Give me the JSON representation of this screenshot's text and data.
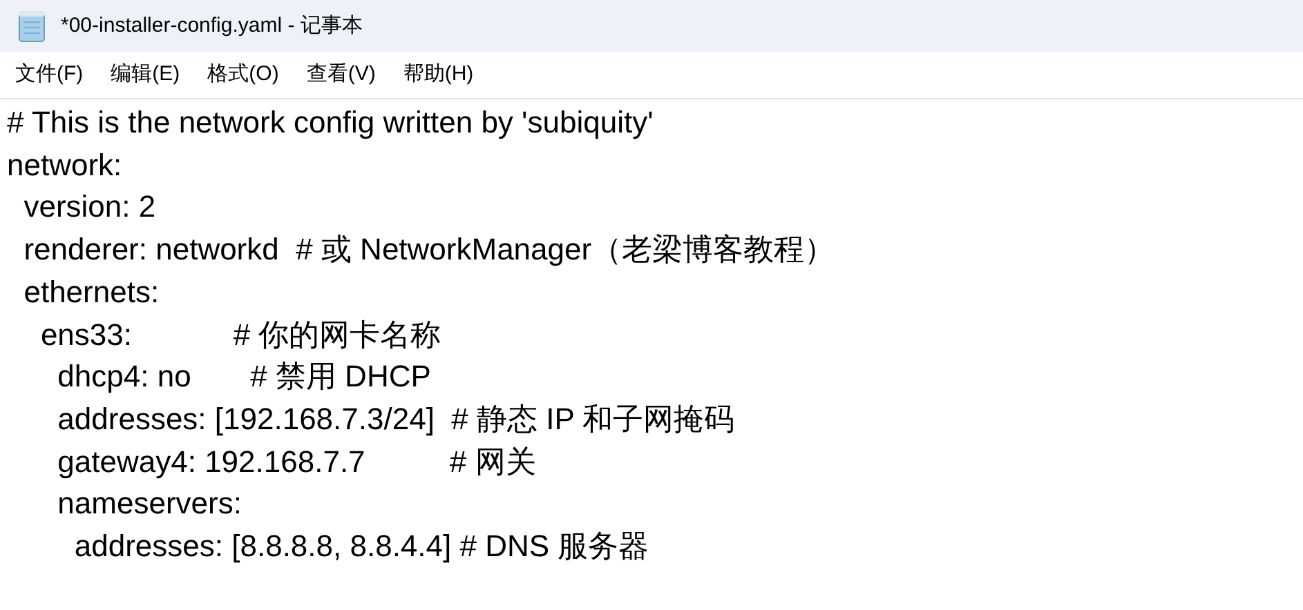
{
  "window": {
    "title": "*00-installer-config.yaml - 记事本"
  },
  "menu": [
    "文件(F)",
    "编辑(E)",
    "格式(O)",
    "查看(V)",
    "帮助(H)"
  ],
  "editor": {
    "lines": [
      "# This is the network config written by 'subiquity'",
      "network:",
      "  version: 2",
      "  renderer: networkd  # 或 NetworkManager（老梁博客教程）",
      "  ethernets:",
      "    ens33:            # 你的网卡名称",
      "      dhcp4: no       # 禁用 DHCP",
      "      addresses: [192.168.7.3/24]  # 静态 IP 和子网掩码",
      "      gateway4: 192.168.7.7          # 网关",
      "      nameservers:",
      "        addresses: [8.8.8.8, 8.8.4.4] # DNS 服务器"
    ]
  }
}
